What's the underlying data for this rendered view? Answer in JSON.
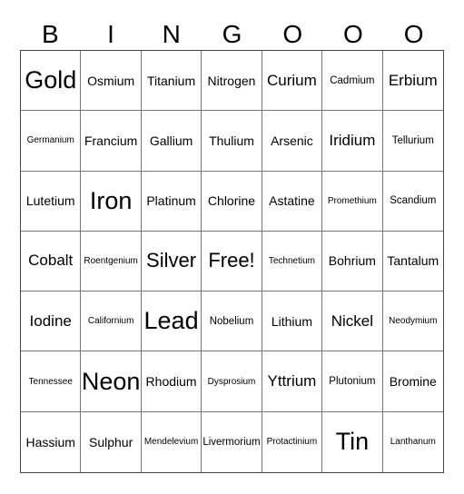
{
  "title_letters": [
    "B",
    "I",
    "N",
    "G",
    "O",
    "O",
    "O"
  ],
  "cells": [
    {
      "text": "Gold",
      "size": "xxl"
    },
    {
      "text": "Osmium",
      "size": "md"
    },
    {
      "text": "Titanium",
      "size": "md"
    },
    {
      "text": "Nitrogen",
      "size": "md"
    },
    {
      "text": "Curium",
      "size": "lg"
    },
    {
      "text": "Cadmium",
      "size": "sm"
    },
    {
      "text": "Erbium",
      "size": "lg"
    },
    {
      "text": "Germanium",
      "size": "xs"
    },
    {
      "text": "Francium",
      "size": "md"
    },
    {
      "text": "Gallium",
      "size": "md"
    },
    {
      "text": "Thulium",
      "size": "md"
    },
    {
      "text": "Arsenic",
      "size": "md"
    },
    {
      "text": "Iridium",
      "size": "lg"
    },
    {
      "text": "Tellurium",
      "size": "sm"
    },
    {
      "text": "Lutetium",
      "size": "md"
    },
    {
      "text": "Iron",
      "size": "xxl"
    },
    {
      "text": "Platinum",
      "size": "md"
    },
    {
      "text": "Chlorine",
      "size": "md"
    },
    {
      "text": "Astatine",
      "size": "md"
    },
    {
      "text": "Promethium",
      "size": "xs"
    },
    {
      "text": "Scandium",
      "size": "sm"
    },
    {
      "text": "Cobalt",
      "size": "lg"
    },
    {
      "text": "Roentgenium",
      "size": "xs"
    },
    {
      "text": "Silver",
      "size": "xl"
    },
    {
      "text": "Free!",
      "size": "xl"
    },
    {
      "text": "Technetium",
      "size": "xs"
    },
    {
      "text": "Bohrium",
      "size": "md"
    },
    {
      "text": "Tantalum",
      "size": "md"
    },
    {
      "text": "Iodine",
      "size": "lg"
    },
    {
      "text": "Californium",
      "size": "xs"
    },
    {
      "text": "Lead",
      "size": "xxl"
    },
    {
      "text": "Nobelium",
      "size": "sm"
    },
    {
      "text": "Lithium",
      "size": "md"
    },
    {
      "text": "Nickel",
      "size": "lg"
    },
    {
      "text": "Neodymium",
      "size": "xs"
    },
    {
      "text": "Tennessee",
      "size": "xs"
    },
    {
      "text": "Neon",
      "size": "xxl"
    },
    {
      "text": "Rhodium",
      "size": "md"
    },
    {
      "text": "Dysprosium",
      "size": "xs"
    },
    {
      "text": "Yttrium",
      "size": "lg"
    },
    {
      "text": "Plutonium",
      "size": "sm"
    },
    {
      "text": "Bromine",
      "size": "md"
    },
    {
      "text": "Hassium",
      "size": "md"
    },
    {
      "text": "Sulphur",
      "size": "md"
    },
    {
      "text": "Mendelevium",
      "size": "xs"
    },
    {
      "text": "Livermorium",
      "size": "sm"
    },
    {
      "text": "Protactinium",
      "size": "xs"
    },
    {
      "text": "Tin",
      "size": "xxl"
    },
    {
      "text": "Lanthanum",
      "size": "xs"
    }
  ]
}
